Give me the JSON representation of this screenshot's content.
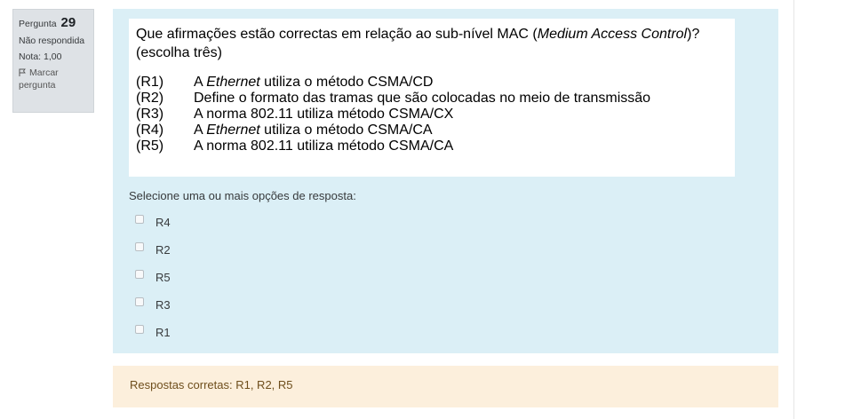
{
  "info": {
    "question_label": "Pergunta",
    "question_number": "29",
    "state": "Não respondida",
    "grade": "Nota: 1,00",
    "flag_label": "Marcar pergunta"
  },
  "question": {
    "text_a": "Que afirmações estão correctas em relação ao sub-nível MAC (",
    "text_em": "Medium Access Control",
    "text_b": ")? (escolha três)",
    "statements": [
      {
        "code": "(R1)",
        "pre": "A ",
        "em": "Ethernet",
        "post": " utiliza o método CSMA/CD"
      },
      {
        "code": "(R2)",
        "pre": "Define o formato das tramas que são colocadas no meio de transmissão",
        "em": "",
        "post": ""
      },
      {
        "code": "(R3)",
        "pre": "A norma 802.11 utiliza método CSMA/CX",
        "em": "",
        "post": ""
      },
      {
        "code": "(R4)",
        "pre": "A ",
        "em": "Ethernet",
        "post": " utiliza o método CSMA/CA"
      },
      {
        "code": "(R5)",
        "pre": "A norma 802.11 utiliza método CSMA/CA",
        "em": "",
        "post": ""
      }
    ]
  },
  "prompt": "Selecione uma ou mais opções de resposta:",
  "options": [
    {
      "label": "R4",
      "checked": false
    },
    {
      "label": "R2",
      "checked": false
    },
    {
      "label": "R5",
      "checked": false
    },
    {
      "label": "R3",
      "checked": false
    },
    {
      "label": "R1",
      "checked": false
    }
  ],
  "feedback": {
    "right_answer": "Respostas corretas: R1, R2, R5"
  },
  "colors": {
    "formulation_bg": "#dbeff6",
    "info_bg": "#dee2e6",
    "outcome_bg": "#fcefdc",
    "outcome_text": "#6e4e1c"
  }
}
